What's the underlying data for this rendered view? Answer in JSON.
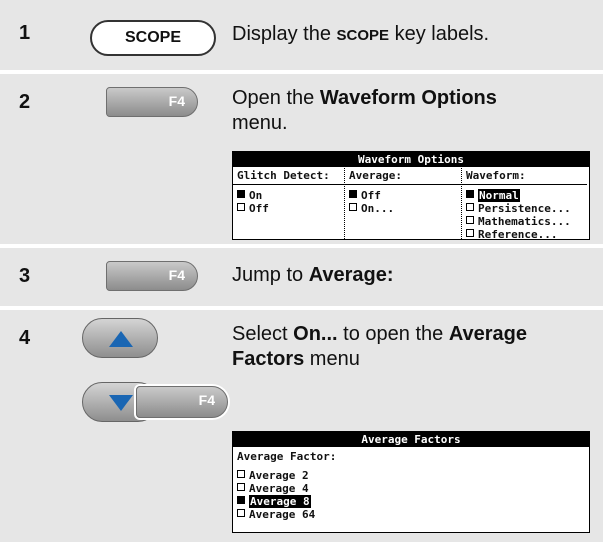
{
  "steps": [
    {
      "number": "1",
      "key": "SCOPE",
      "desc_parts": [
        "Display the ",
        "SCOPE",
        " key labels."
      ]
    },
    {
      "number": "2",
      "key": "F4",
      "desc_parts": [
        "Open the ",
        "Waveform Options",
        " menu."
      ]
    },
    {
      "number": "3",
      "key": "F4",
      "desc_parts": [
        "Jump to ",
        "Average:"
      ]
    },
    {
      "number": "4",
      "key": "F4",
      "desc_parts": [
        "Select ",
        "On...",
        " to open the ",
        "Average Factors",
        " menu"
      ]
    }
  ],
  "waveform_menu": {
    "title": "Waveform Options",
    "columns": [
      {
        "header": "Glitch Detect:",
        "options": [
          {
            "label": "On",
            "selected": true
          },
          {
            "label": "Off",
            "selected": false
          }
        ]
      },
      {
        "header": "Average:",
        "options": [
          {
            "label": "Off",
            "selected": true
          },
          {
            "label": "On...",
            "selected": false
          }
        ]
      },
      {
        "header": "Waveform:",
        "options": [
          {
            "label": "Normal",
            "selected": true,
            "highlight": true
          },
          {
            "label": "Persistence...",
            "selected": false
          },
          {
            "label": "Mathematics...",
            "selected": false
          },
          {
            "label": "Reference...",
            "selected": false
          }
        ]
      }
    ]
  },
  "average_menu": {
    "title": "Average Factors",
    "header": "Average Factor:",
    "options": [
      {
        "label": "Average 2",
        "selected": false
      },
      {
        "label": "Average 4",
        "selected": false
      },
      {
        "label": "Average 8",
        "selected": true,
        "highlight": true
      },
      {
        "label": "Average 64",
        "selected": false
      }
    ]
  },
  "icons": {
    "up": "up-arrow-icon",
    "down": "down-arrow-icon"
  }
}
